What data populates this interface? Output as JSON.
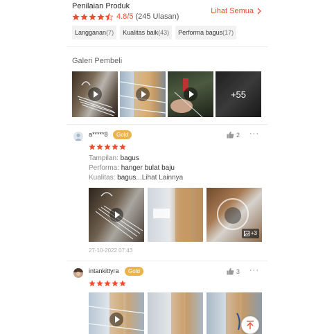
{
  "header": {
    "title": "Penilaian Produk",
    "rating": "4.8/5",
    "count": "(245 Ulasan)",
    "see_all": "Lihat Semua",
    "stars_filled": 4.5,
    "chips": [
      {
        "label": "Langganan",
        "count": "(7)"
      },
      {
        "label": "Kualitas baik",
        "count": "(43)"
      },
      {
        "label": "Performa bagus",
        "count": "(17)"
      }
    ]
  },
  "gallery": {
    "title": "Galeri Pembeli",
    "more": "+55"
  },
  "reviews": [
    {
      "user": "a*****8",
      "badge": "Gold",
      "likes": "2",
      "stars": 5,
      "lines": [
        {
          "k": "Tampilan: ",
          "v": "bagus"
        },
        {
          "k": "Performa: ",
          "v": "hanger bulat baju"
        },
        {
          "k": "Kualitas: ",
          "v": "bagus",
          "more": "...Lihat Lainnya"
        }
      ],
      "photo_more": "+3",
      "date": "27-10-2022 07:43"
    },
    {
      "user": "intankittyra",
      "badge": "Gold",
      "likes": "3",
      "stars": 5
    }
  ],
  "colors": {
    "accent": "#ee4d2d",
    "star": "#ee4d2d",
    "gold": "#e9b44c"
  }
}
